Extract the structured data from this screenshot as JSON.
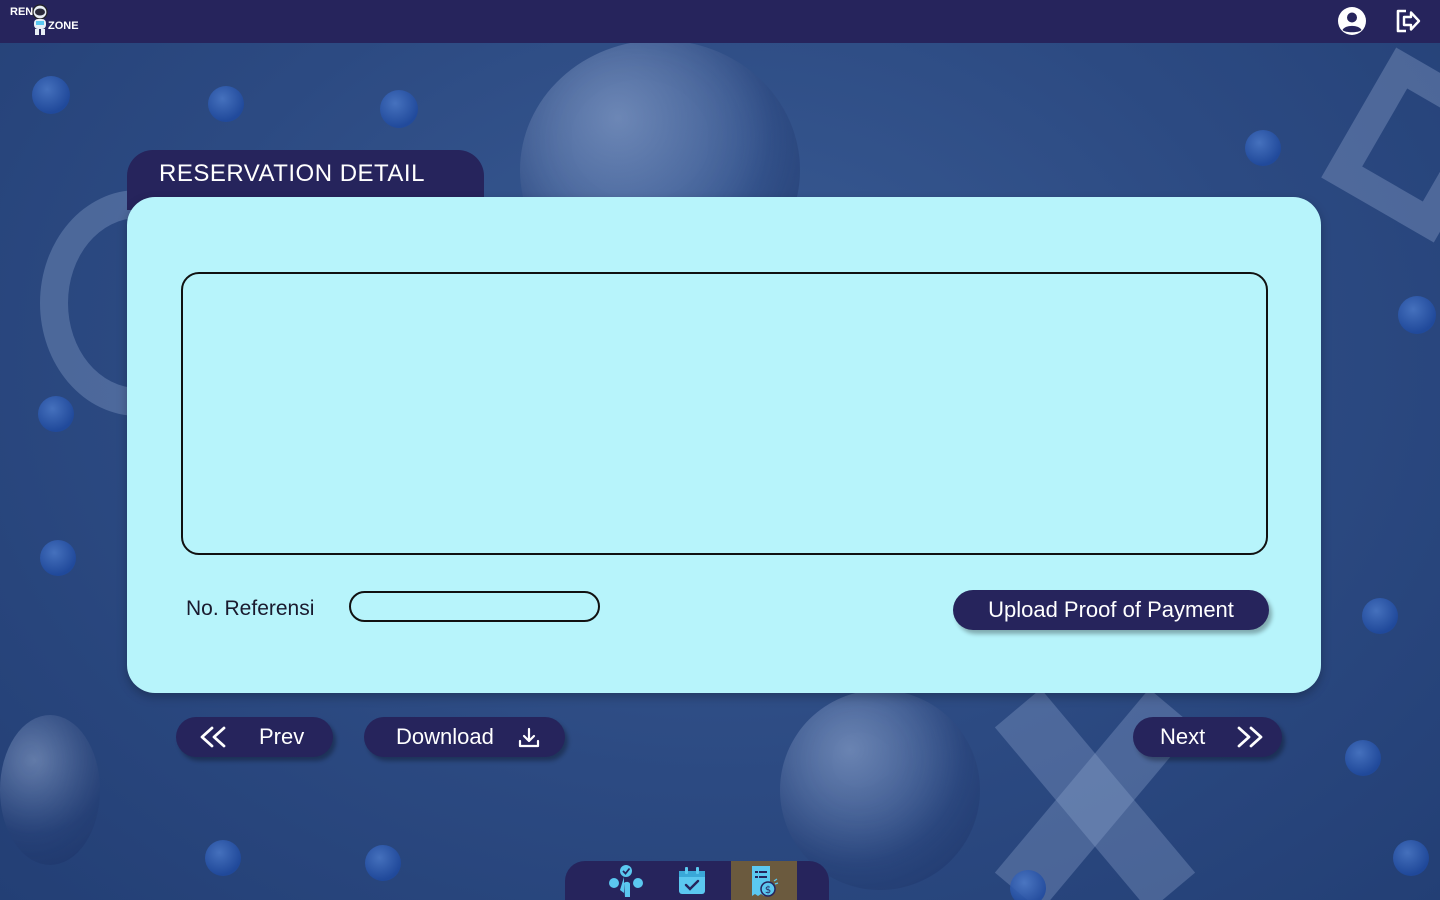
{
  "app": {
    "logo_text_top": "REN",
    "logo_text_bottom": "ZONE"
  },
  "header": {
    "icons": [
      "user-circle-icon",
      "logout-icon"
    ]
  },
  "reservation": {
    "title": "RESERVATION DETAIL",
    "detail_content": "",
    "reference_label": "No. Referensi",
    "reference_value": "",
    "upload_label": "Upload Proof of Payment"
  },
  "navigation": {
    "prev_label": "Prev",
    "download_label": "Download",
    "next_label": "Next"
  },
  "bottom_nav": {
    "items": [
      {
        "icon": "select-tap-icon",
        "active": false
      },
      {
        "icon": "calendar-check-icon",
        "active": false
      },
      {
        "icon": "receipt-payment-icon",
        "active": true
      }
    ]
  },
  "colors": {
    "primary": "#26245c",
    "card": "#b7f4fb",
    "background": "#2f4f86",
    "active_tab": "#6b5a3e",
    "accent": "#5bc8f0"
  }
}
